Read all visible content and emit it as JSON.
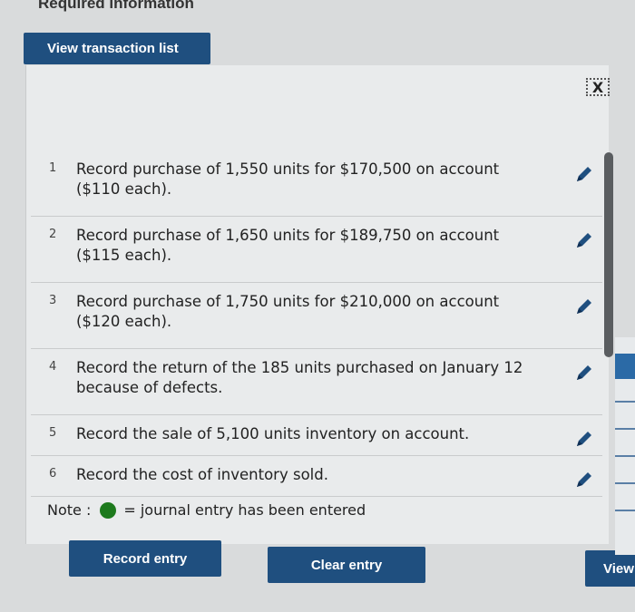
{
  "header": {
    "title": "Required information"
  },
  "tabs": {
    "view_transaction_list": "View transaction list"
  },
  "close": {
    "label": "X"
  },
  "transactions": [
    {
      "num": "1",
      "text": "Record purchase of 1,550 units for $170,500 on account ($110 each)."
    },
    {
      "num": "2",
      "text": "Record purchase of 1,650 units for $189,750 on account ($115 each)."
    },
    {
      "num": "3",
      "text": "Record purchase of 1,750 units for $210,000 on account ($120 each)."
    },
    {
      "num": "4",
      "text": "Record the return of the 185 units purchased on January 12 because of defects."
    },
    {
      "num": "5",
      "text": "Record the sale of 5,100 units inventory on account."
    },
    {
      "num": "6",
      "text": "Record the cost of inventory sold."
    }
  ],
  "note": {
    "label": "Note :",
    "text": "= journal entry has been entered"
  },
  "buttons": {
    "record": "Record entry",
    "clear": "Clear entry",
    "view": "View"
  },
  "colors": {
    "button_blue": "#1f4f7f",
    "entered_dot": "#1d7a1d"
  },
  "icons": {
    "edit": "pencil-icon",
    "close": "close-icon"
  }
}
